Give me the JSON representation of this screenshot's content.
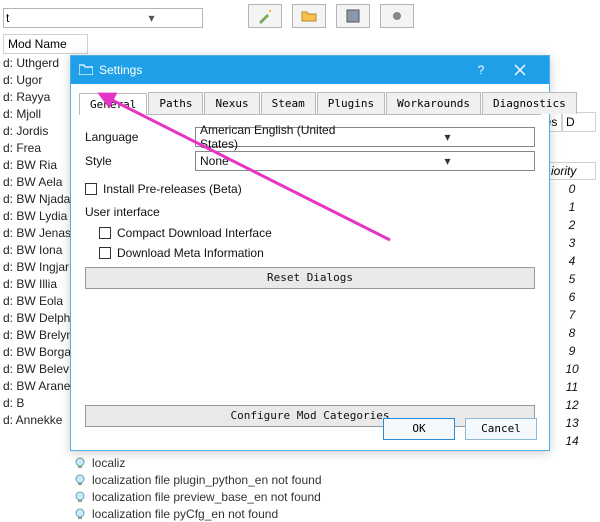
{
  "bg": {
    "search_value": "t",
    "list_header": "Mod Name",
    "list_items": [
      "d: Uthgerd",
      "d: Ugor",
      "d: Rayya",
      "d: Mjoll",
      "d: Jordis",
      "d: Frea",
      "d: BW Ria",
      "d: BW Aela",
      "d: BW Njada",
      "d: BW Lydia",
      "d: BW Jenas",
      "d: BW Iona",
      "d: BW Ingjar",
      "d: BW Illia",
      "d: BW Eola",
      "d: BW Delphi",
      "d: BW Brelyn",
      "d: BW Borga",
      "d: BW Belev",
      "d: BW Arane",
      "d: B",
      "d: Annekke"
    ],
    "right_cols": [
      "aves",
      "D"
    ],
    "priority_header": "iority",
    "priorities": [
      "0",
      "1",
      "2",
      "3",
      "4",
      "5",
      "6",
      "7",
      "8",
      "9",
      "10",
      "11",
      "12",
      "13",
      "14"
    ],
    "log": [
      "localiz",
      "localization file plugin_python_en not found",
      "localization file preview_base_en not found",
      "localization file pyCfg_en not found"
    ]
  },
  "dialog": {
    "title": "Settings",
    "tabs": [
      "General",
      "Paths",
      "Nexus",
      "Steam",
      "Plugins",
      "Workarounds",
      "Diagnostics"
    ],
    "active_tab": 0,
    "language_label": "Language",
    "language_value": "American English (United States)",
    "style_label": "Style",
    "style_value": "None",
    "install_pre_label": "Install Pre-releases (Beta)",
    "ui_section": "User interface",
    "compact_label": "Compact Download Interface",
    "meta_label": "Download Meta Information",
    "reset_label": "Reset Dialogs",
    "configure_label": "Configure Mod Categories",
    "ok": "OK",
    "cancel": "Cancel"
  }
}
